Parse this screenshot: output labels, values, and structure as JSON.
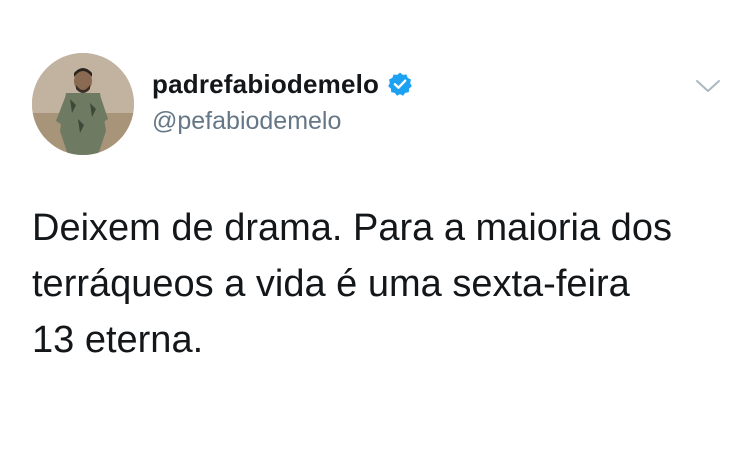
{
  "tweet": {
    "display_name": "padrefabiodemelo",
    "handle": "@pefabiodemelo",
    "verified": true,
    "text": "Deixem de drama. Para a maioria dos\nterráqueos a vida é uma sexta-feira\n13 eterna.",
    "icons": {
      "verified": "verified-badge-icon",
      "menu": "chevron-down-icon"
    }
  },
  "colors": {
    "text": "#14171a",
    "secondary": "#657786",
    "verified_blue": "#1da1f2",
    "caret": "#aab8c2"
  }
}
